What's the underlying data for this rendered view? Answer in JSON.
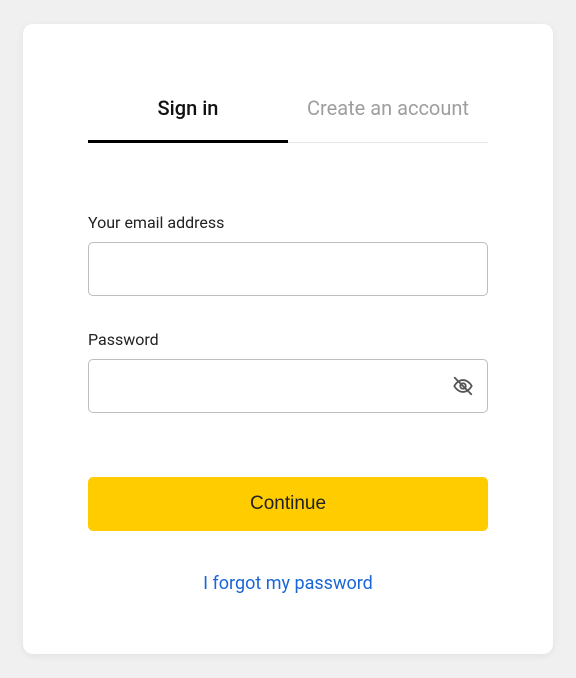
{
  "tabs": {
    "signin": "Sign in",
    "create": "Create an account"
  },
  "form": {
    "email_label": "Your email address",
    "email_value": "",
    "password_label": "Password",
    "password_value": ""
  },
  "actions": {
    "continue": "Continue",
    "forgot": "I forgot my password"
  }
}
